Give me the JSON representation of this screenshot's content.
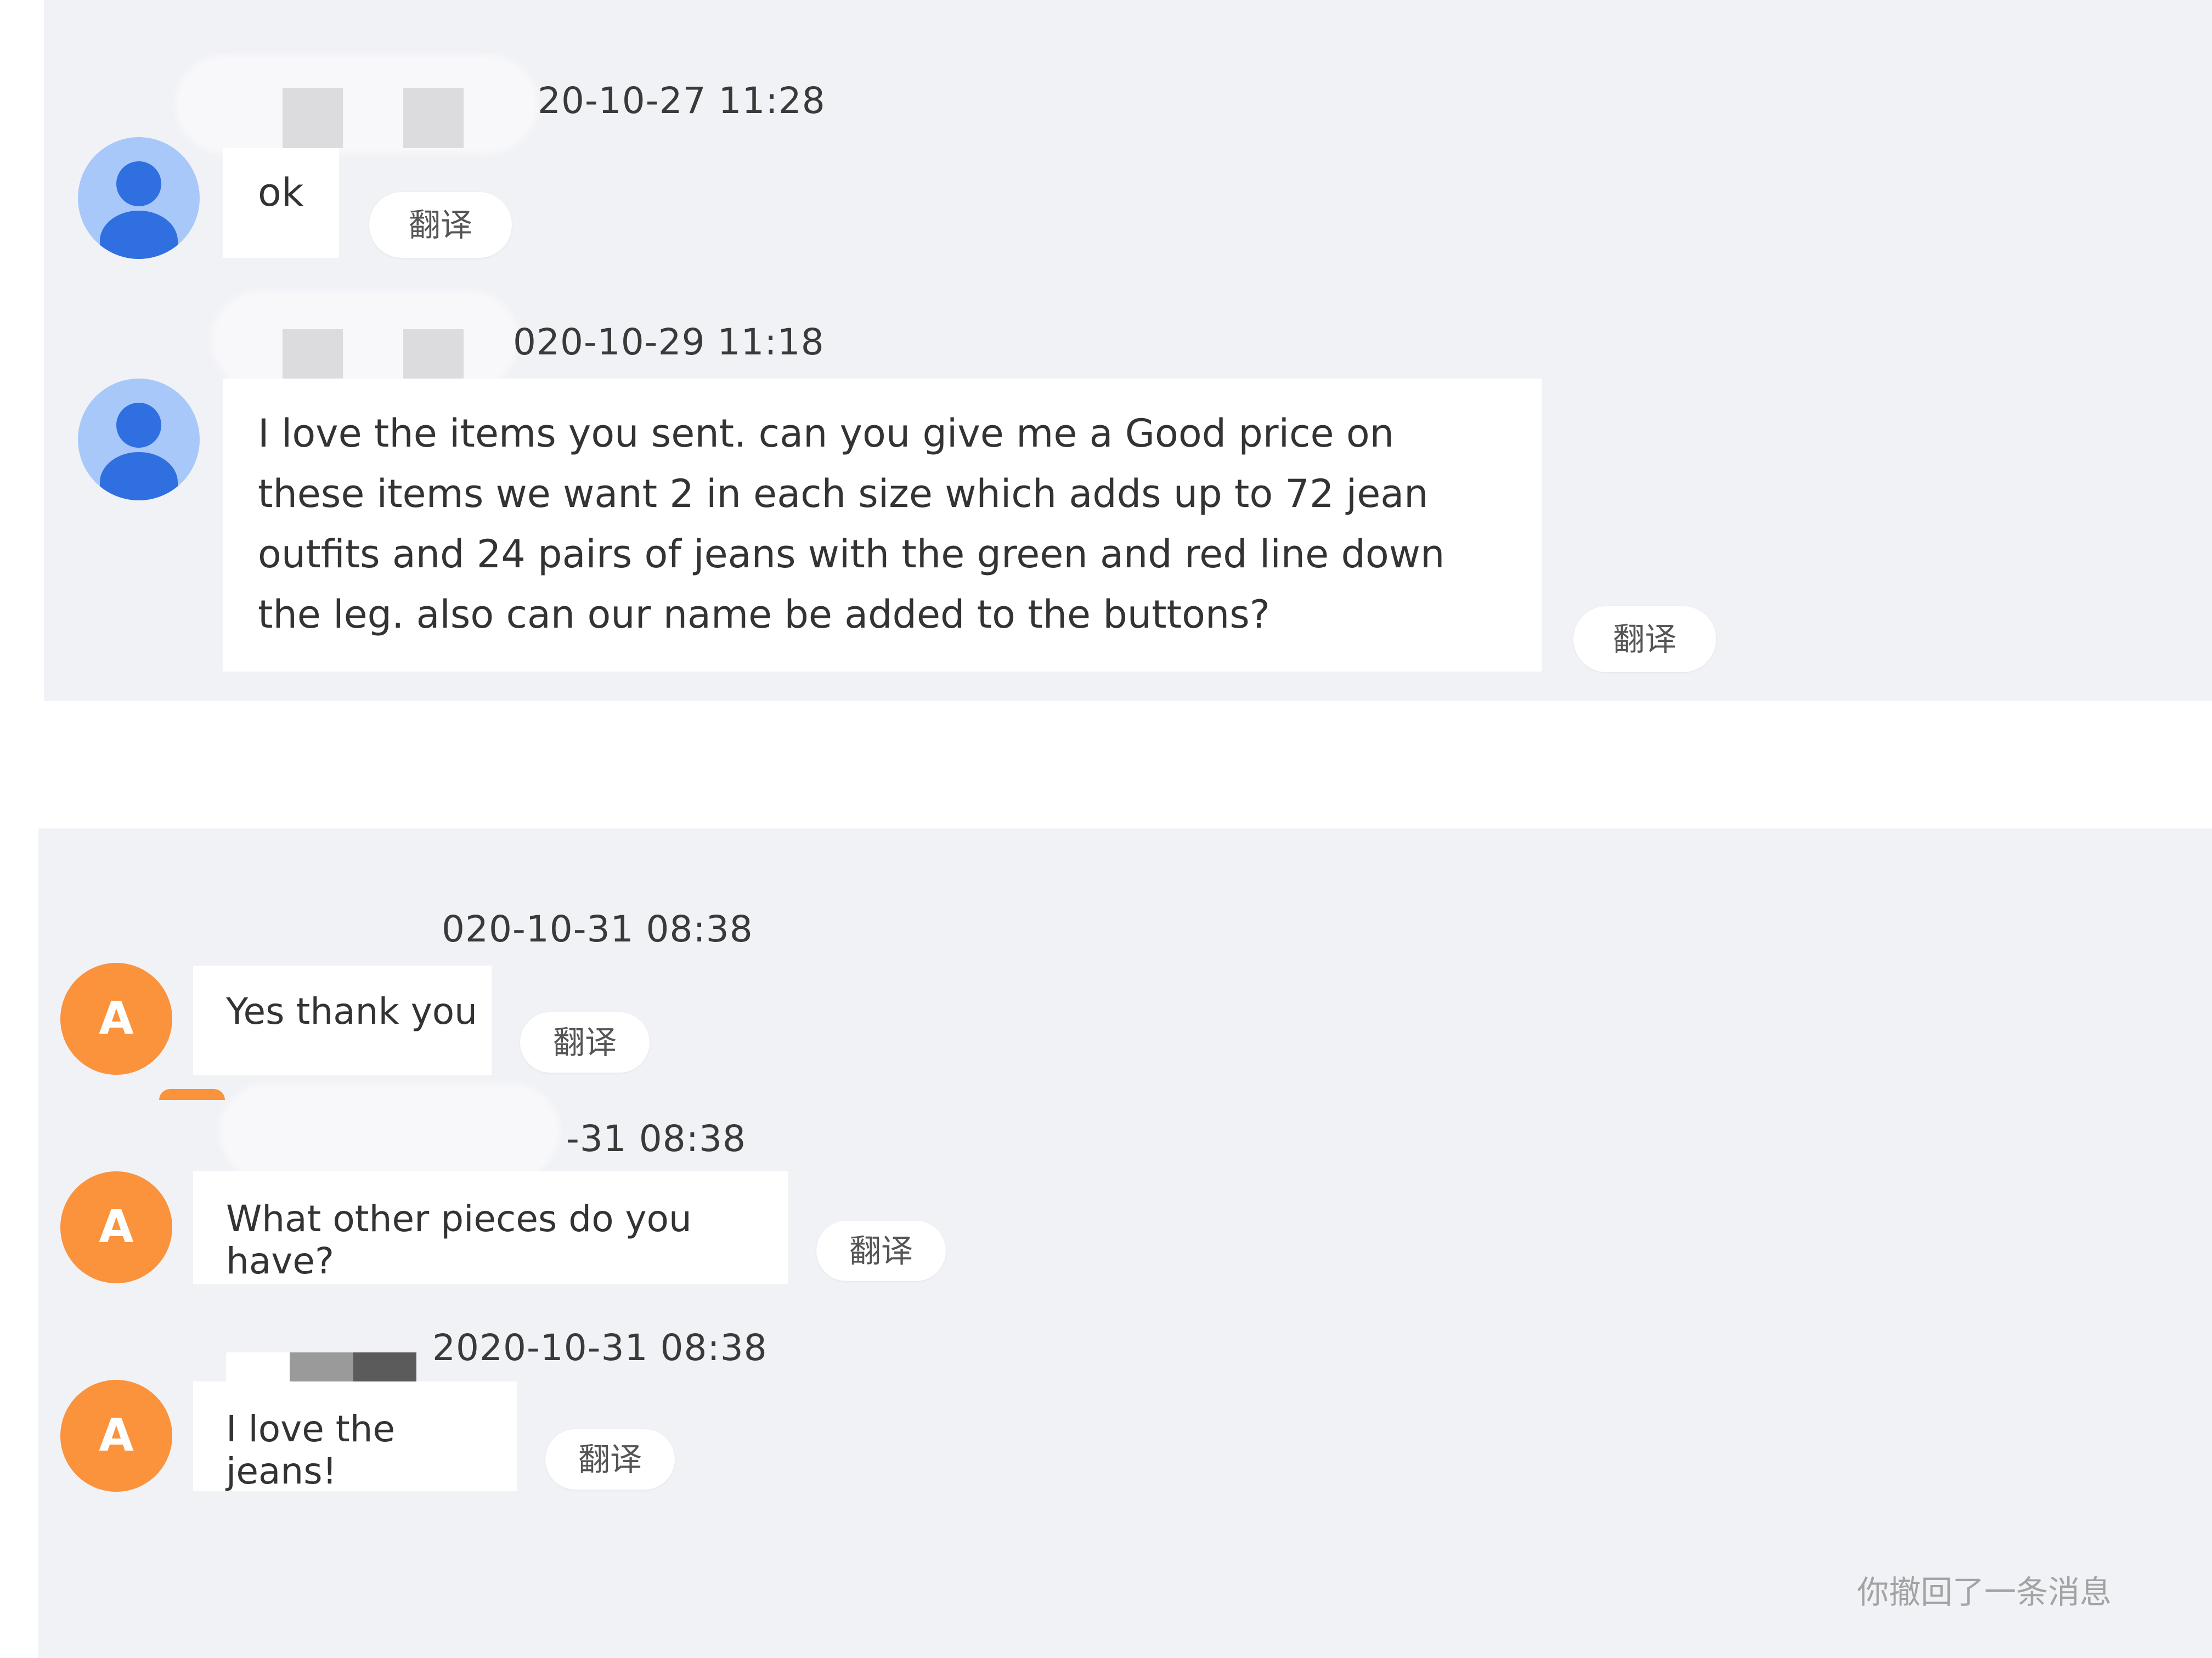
{
  "translate_label": "翻译",
  "messages": [
    {
      "timestamp": "20-10-27 11:28",
      "text": "ok",
      "avatar": "user-silhouette-icon",
      "accent": "#2f6fe0"
    },
    {
      "timestamp": "020-10-29 11:18",
      "text": "I love the items you sent. can you give me a Good price on these items we want 2 in each size which adds up to 72 jean outfits and 24 pairs of jeans with the green and red line down the leg. also can our name be added to the buttons?",
      "avatar": "user-silhouette-icon",
      "accent": "#2f6fe0"
    },
    {
      "timestamp": "020-10-31 08:38",
      "text": "Yes thank you",
      "avatar_letter": "A",
      "accent": "#fb923c"
    },
    {
      "timestamp": "-31 08:38",
      "text": "What other pieces do you have?",
      "avatar_letter": "A",
      "accent": "#fb923c"
    },
    {
      "timestamp": "2020-10-31 08:38",
      "text": "I love the jeans!",
      "avatar_letter": "A",
      "accent": "#fb923c"
    }
  ],
  "recall_notice": "你撤回了一条消息"
}
